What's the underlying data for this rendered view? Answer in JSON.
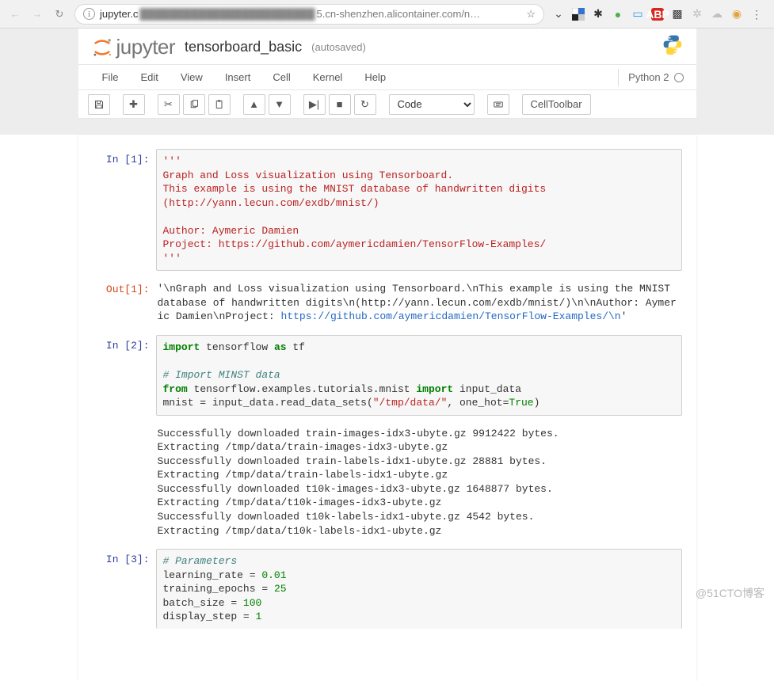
{
  "browser": {
    "url_prefix": "jupyter.c",
    "url_blurred": "████████████████████████",
    "url_suffix": "5.cn-shenzhen.alicontainer.com/n…"
  },
  "header": {
    "logo_text": "jupyter",
    "title": "tensorboard_basic",
    "autosave": "(autosaved)"
  },
  "menubar": {
    "items": [
      "File",
      "Edit",
      "View",
      "Insert",
      "Cell",
      "Kernel",
      "Help"
    ],
    "kernel": "Python 2"
  },
  "toolbar": {
    "celltype": "Code",
    "celltoolbar": "CellToolbar"
  },
  "cells": [
    {
      "in_prompt": "In [1]:",
      "code_html": "<span class='s-str'>'''\nGraph and Loss visualization using Tensorboard.\nThis example is using the MNIST database of handwritten digits\n(http://yann.lecun.com/exdb/mnist/)\n\nAuthor: Aymeric Damien\nProject: https://github.com/aymericdamien/TensorFlow-Examples/\n'''</span>",
      "out_prompt": "Out[1]:",
      "out_html": "'\\nGraph and Loss visualization using Tensorboard.\\nThis example is using the MNIST database of handwritten digits\\n(http://yann.lecun.com/exdb/mnist/)\\n\\nAuthor: Aymeric Damien\\nProject: <span class='link'>https://github.com/aymericdamien/TensorFlow-Examples/\\n</span>'"
    },
    {
      "in_prompt": "In [2]:",
      "code_html": "<span class='s-kw'>import</span> tensorflow <span class='s-kw'>as</span> tf\n\n<span class='s-com'># Import MINST data</span>\n<span class='s-kw'>from</span> tensorflow.examples.tutorials.mnist <span class='s-kw'>import</span> input_data\nmnist = input_data.read_data_sets(<span class='s-str'>\"/tmp/data/\"</span>, one_hot=<span class='s-const'>True</span>)",
      "stdout": "Successfully downloaded train-images-idx3-ubyte.gz 9912422 bytes.\nExtracting /tmp/data/train-images-idx3-ubyte.gz\nSuccessfully downloaded train-labels-idx1-ubyte.gz 28881 bytes.\nExtracting /tmp/data/train-labels-idx1-ubyte.gz\nSuccessfully downloaded t10k-images-idx3-ubyte.gz 1648877 bytes.\nExtracting /tmp/data/t10k-images-idx3-ubyte.gz\nSuccessfully downloaded t10k-labels-idx1-ubyte.gz 4542 bytes.\nExtracting /tmp/data/t10k-labels-idx1-ubyte.gz"
    },
    {
      "in_prompt": "In [3]:",
      "code_html": "<span class='s-com'># Parameters</span>\nlearning_rate = <span class='s-num'>0.01</span>\ntraining_epochs = <span class='s-num'>25</span>\nbatch_size = <span class='s-num'>100</span>\ndisplay_step = <span class='s-num'>1</span>"
    }
  ],
  "watermark": "@51CTO博客"
}
